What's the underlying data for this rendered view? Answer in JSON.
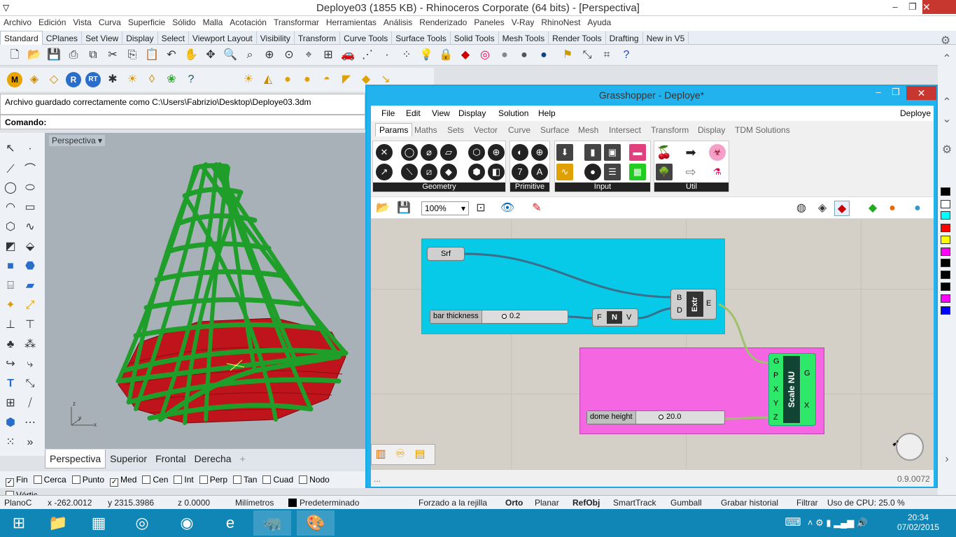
{
  "window": {
    "title": "Deploye03 (1855 KB) - Rhinoceros Corporate (64 bits) - [Perspectiva]"
  },
  "menu": [
    "Archivo",
    "Edición",
    "Vista",
    "Curva",
    "Superficie",
    "Sólido",
    "Malla",
    "Acotación",
    "Transformar",
    "Herramientas",
    "Análisis",
    "Renderizado",
    "Paneles",
    "V-Ray",
    "RhinoNest",
    "Ayuda"
  ],
  "tabs": [
    "Standard",
    "CPlanes",
    "Set View",
    "Display",
    "Select",
    "Viewport Layout",
    "Visibility",
    "Transform",
    "Curve Tools",
    "Surface Tools",
    "Solid Tools",
    "Mesh Tools",
    "Render Tools",
    "Drafting",
    "New in V5"
  ],
  "command": {
    "history": "Archivo guardado correctamente como C:\\Users\\Fabrizio\\Desktop\\Deploye03.3dm",
    "prompt": "Comando:"
  },
  "viewport": {
    "name": "Perspectiva",
    "tabs": [
      "Perspectiva",
      "Superior",
      "Frontal",
      "Derecha"
    ]
  },
  "osnaps": [
    {
      "label": "Fin",
      "checked": true
    },
    {
      "label": "Cerca",
      "checked": false
    },
    {
      "label": "Punto",
      "checked": false
    },
    {
      "label": "Med",
      "checked": true
    },
    {
      "label": "Cen",
      "checked": false
    },
    {
      "label": "Int",
      "checked": false
    },
    {
      "label": "Perp",
      "checked": false
    },
    {
      "label": "Tan",
      "checked": false
    },
    {
      "label": "Cuad",
      "checked": false
    },
    {
      "label": "Nodo",
      "checked": false
    },
    {
      "label": "Vértic",
      "checked": false
    }
  ],
  "status": {
    "plane": "PlanoC",
    "x": "x -262.0012",
    "y": "y 2315.3986",
    "z": "z 0.0000",
    "units": "Milímetros",
    "layer": "Predeterminado",
    "grid": "Forzado a la rejilla",
    "ortho": "Orto",
    "planar": "Planar",
    "refobj": "RefObj",
    "smarttrack": "SmartTrack",
    "gumball": "Gumball",
    "history": "Grabar historial",
    "filter": "Filtrar",
    "cpu": "Uso de CPU: 25.0 %"
  },
  "taskbar": {
    "time": "20:34",
    "date": "07/02/2015"
  },
  "gh": {
    "title": "Grasshopper - Deploye*",
    "menu": [
      "File",
      "Edit",
      "View",
      "Display",
      "Solution",
      "Help"
    ],
    "doc": "Deploye",
    "tabs": [
      "Params",
      "Maths",
      "Sets",
      "Vector",
      "Curve",
      "Surface",
      "Mesh",
      "Intersect",
      "Transform",
      "Display",
      "TDM Solutions"
    ],
    "panels": [
      "Geometry",
      "Primitive",
      "Input",
      "Util"
    ],
    "zoom": "100%",
    "version": "0.9.0072",
    "footer_left": "...",
    "nodes": {
      "srf": "Srf",
      "extr": "Extr",
      "extr_in": [
        "B",
        "D"
      ],
      "extr_out": "E",
      "neg": "N",
      "neg_in": "F",
      "neg_out": "V",
      "scale": "Scale NU",
      "scale_in": [
        "G",
        "P",
        "X",
        "Y",
        "Z"
      ],
      "scale_out": [
        "G",
        "X"
      ]
    },
    "sliders": [
      {
        "label": "bar thickness",
        "value": "0.2"
      },
      {
        "label": "dome height",
        "value": "20.0"
      }
    ]
  },
  "colors": {
    "group_blue": "#07c9e8",
    "group_pink": "#f566e3",
    "mesh_green": "#1f9e2a",
    "mesh_red": "#c0141c",
    "taskbar": "#0f86b5"
  }
}
